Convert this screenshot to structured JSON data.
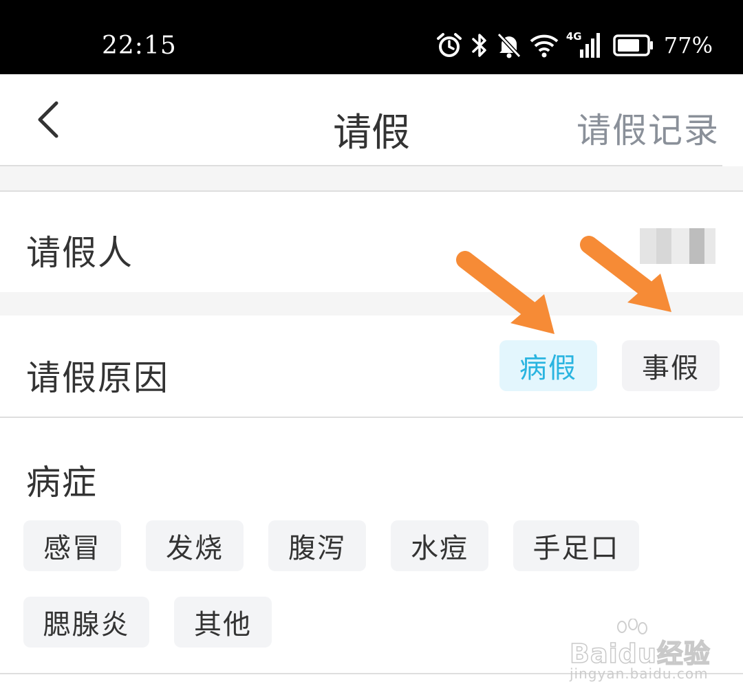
{
  "status_bar": {
    "time": "22:15",
    "icons": [
      "alarm-icon",
      "bluetooth-icon",
      "mute-icon",
      "wifi-icon",
      "signal-4g-icon",
      "battery-icon"
    ],
    "network_label": "4G",
    "battery_percent": "77%",
    "battery_level": 0.77
  },
  "header": {
    "title": "请假",
    "back_icon": "chevron-left-icon",
    "record_link": "请假记录"
  },
  "applicant": {
    "label": "请假人"
  },
  "reason": {
    "label": "请假原因",
    "options": [
      {
        "label": "病假",
        "selected": true
      },
      {
        "label": "事假",
        "selected": false
      }
    ]
  },
  "symptoms": {
    "label": "病症",
    "tags": [
      "感冒",
      "发烧",
      "腹泻",
      "水痘",
      "手足口",
      "腮腺炎",
      "其他"
    ]
  },
  "watermark": {
    "brand": "Baidu经验",
    "url": "jingyan.baidu.com"
  },
  "colors": {
    "selected_text": "#29b4e0",
    "selected_bg": "#e3f6fd",
    "tag_bg": "#f3f4f6",
    "arrow": "#f68b36",
    "link_gray": "#8a9099"
  }
}
